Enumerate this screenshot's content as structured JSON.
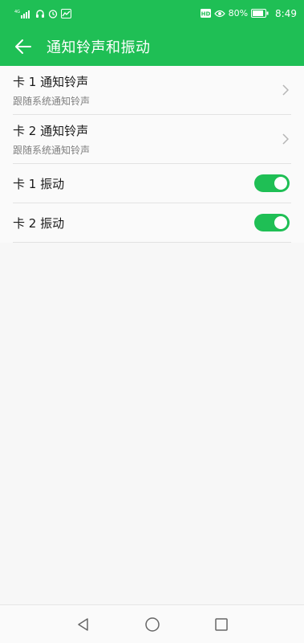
{
  "status_bar": {
    "network": "4G",
    "battery_percent": "80%",
    "time": "8:49",
    "hd_badge": "HD"
  },
  "header": {
    "title": "通知铃声和振动"
  },
  "rows": [
    {
      "title": "卡 1 通知铃声",
      "subtitle": "跟随系统通知铃声"
    },
    {
      "title": "卡 2 通知铃声",
      "subtitle": "跟随系统通知铃声"
    },
    {
      "title": "卡 1 振动",
      "toggle_on": true
    },
    {
      "title": "卡 2 振动",
      "toggle_on": true
    }
  ],
  "colors": {
    "accent": "#1fbf55",
    "background": "#f7f7f7"
  },
  "icons": {
    "back": "arrow-left-icon",
    "chevron": "chevron-right-icon",
    "nav_back": "triangle-back-icon",
    "nav_home": "circle-home-icon",
    "nav_recent": "square-recent-icon"
  }
}
